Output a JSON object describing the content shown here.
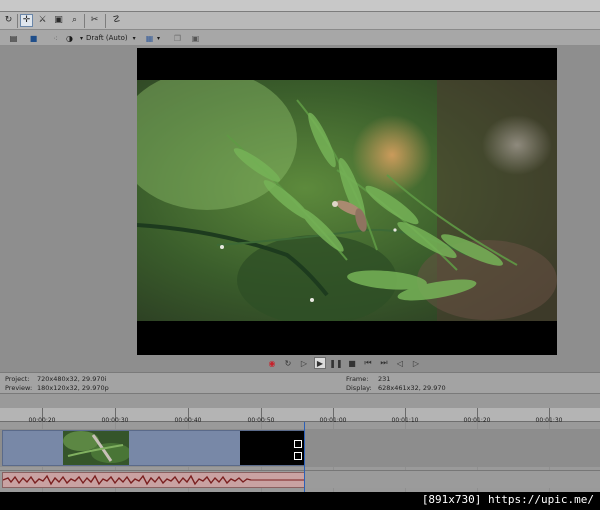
{
  "toolbar": {
    "preview_quality": "Draft (Auto)"
  },
  "transport": {
    "buttons": [
      "record",
      "loop",
      "play-from-start",
      "play",
      "pause",
      "stop",
      "prev-frame-start",
      "next-frame-end",
      "prev-frame",
      "next-frame"
    ]
  },
  "info": {
    "project_label": "Project:",
    "project_value": "720x480x32, 29.970i",
    "preview_label": "Preview:",
    "preview_value": "180x120x32, 29.970p",
    "frame_label": "Frame:",
    "frame_value": "231",
    "display_label": "Display:",
    "display_value": "628x461x32, 29.970"
  },
  "timeline": {
    "ticks": [
      "00:00:20",
      "00:00:30",
      "00:00:40",
      "00:00:50",
      "00:01:00",
      "00:01:10",
      "00:01:20",
      "00:01:30"
    ]
  },
  "watermark": "[891x730] https://upic.me/",
  "colors": {
    "accent": "#2b5fb8",
    "event_video": "#7888a7",
    "event_audio": "#c9a2a2",
    "record": "#c8202a"
  }
}
